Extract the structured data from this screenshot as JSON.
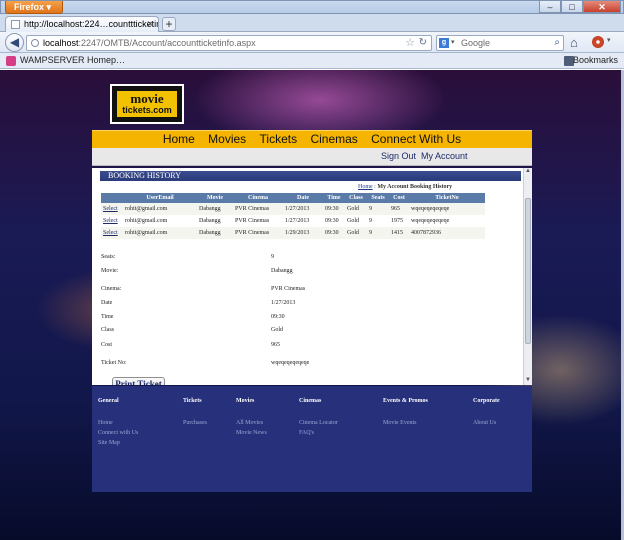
{
  "browser": {
    "app_button": "Firefox",
    "tab_title": "http://localhost:224…counttticketinfo.aspx",
    "url_host": "localhost",
    "url_path": ":2247/OMTB/Account/accountticketinfo.aspx",
    "search_placeholder": "Google",
    "bookmark_link": "WAMPSERVER Homep…",
    "bookmarks_label": "Bookmarks"
  },
  "site": {
    "logo_line1": "movie",
    "logo_line2": "tickets.com",
    "menu": [
      "Home",
      "Movies",
      "Tickets",
      "Cinemas",
      "Connect With Us"
    ],
    "sign_out": "Sign Out",
    "my_account": "My Account"
  },
  "booking": {
    "header": "BOOKING HISTORY",
    "breadcrumb_home": "Home",
    "breadcrumb_sep": " : ",
    "breadcrumb_current": "My Account Booking History",
    "columns": [
      "",
      "UserEmail",
      "Movie",
      "Cinema",
      "Date",
      "Time",
      "Class",
      "Seats",
      "Cost",
      "TicketNo"
    ],
    "rows": [
      {
        "select": "Select",
        "email": "rohit@gmail.com",
        "movie": "Dabangg",
        "cinema": "PVR Cinemas",
        "date": "1/27/2013",
        "time": "09:30",
        "class": "Gold",
        "seats": "9",
        "cost": "965",
        "ticket": "wqeqeqeqeqeqe"
      },
      {
        "select": "Select",
        "email": "rohit@gmail.com",
        "movie": "Dabangg",
        "cinema": "PVR Cinemas",
        "date": "1/27/2013",
        "time": "09:30",
        "class": "Gold",
        "seats": "9",
        "cost": "1975",
        "ticket": "wqeqeqeqeqeqe"
      },
      {
        "select": "Select",
        "email": "rohit@gmail.com",
        "movie": "Dabangg",
        "cinema": "PVR Cinemas",
        "date": "1/29/2013",
        "time": "09:30",
        "class": "Gold",
        "seats": "9",
        "cost": "1415",
        "ticket": "4007872936"
      }
    ],
    "details": [
      {
        "label": "Seats:",
        "value": "9"
      },
      {
        "label": "Movie:",
        "value": "Dabangg"
      },
      {
        "label": "Cinema:",
        "value": "PVR Cinemas"
      },
      {
        "label": "Date",
        "value": "1/27/2013"
      },
      {
        "label": "Time",
        "value": "09:30"
      },
      {
        "label": "Class",
        "value": "Gold"
      },
      {
        "label": "Cost",
        "value": "965"
      },
      {
        "label": "Ticket No:",
        "value": "wqeqeqeqeqeqe"
      }
    ],
    "print_button": "Print Ticket"
  },
  "footer": {
    "columns": [
      {
        "heading": "General",
        "links": [
          "Home",
          "Connect with Us",
          "Site Map"
        ]
      },
      {
        "heading": "Tickets",
        "links": [
          "Purchases"
        ]
      },
      {
        "heading": "Movies",
        "links": [
          "All Movies",
          "Movie News"
        ]
      },
      {
        "heading": "Cinemas",
        "links": [
          "Cinema Locator",
          "FAQ's"
        ]
      },
      {
        "heading": "Events & Promos",
        "links": [
          "Movie Events"
        ]
      },
      {
        "heading": "Corporate",
        "links": [
          "About Us"
        ]
      }
    ]
  },
  "icons": {
    "back": "arrow-left-icon",
    "star": "bookmark-star-icon",
    "reload": "reload-icon",
    "search": "search-icon",
    "home": "home-icon",
    "addon": "addon-icon"
  },
  "colors": {
    "menu_bar": "#f5b400",
    "header_bar": "#2a3a7a",
    "grid_header": "#5a7ba8",
    "footer_bg": "#27307a"
  }
}
